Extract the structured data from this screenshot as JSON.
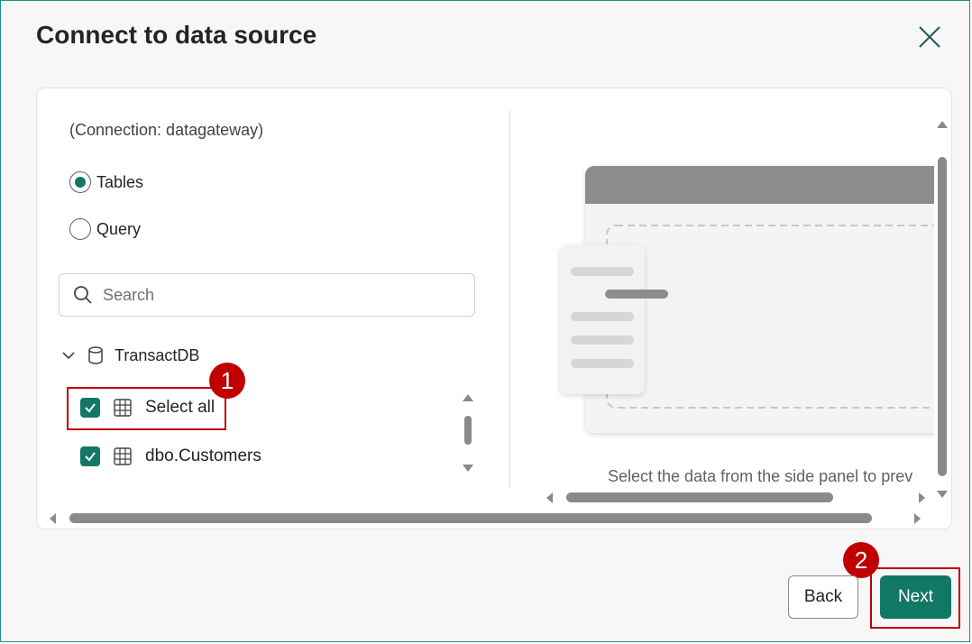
{
  "dialog": {
    "title": "Connect to data source"
  },
  "left_panel": {
    "connection_label": "(Connection: datagateway)",
    "radio_options": [
      {
        "label": "Tables",
        "selected": true
      },
      {
        "label": "Query",
        "selected": false
      }
    ],
    "search": {
      "placeholder": "Search",
      "value": ""
    },
    "tree": {
      "root_label": "TransactDB",
      "items": [
        {
          "label": "Select all",
          "checked": true
        },
        {
          "label": "dbo.Customers",
          "checked": true
        }
      ]
    }
  },
  "right_panel": {
    "caption": "Select the data from the side panel to prev"
  },
  "annotations": {
    "step1": "1",
    "step2": "2"
  },
  "footer": {
    "back_label": "Back",
    "next_label": "Next"
  },
  "colors": {
    "accent": "#117865",
    "annotation": "#c00000"
  }
}
